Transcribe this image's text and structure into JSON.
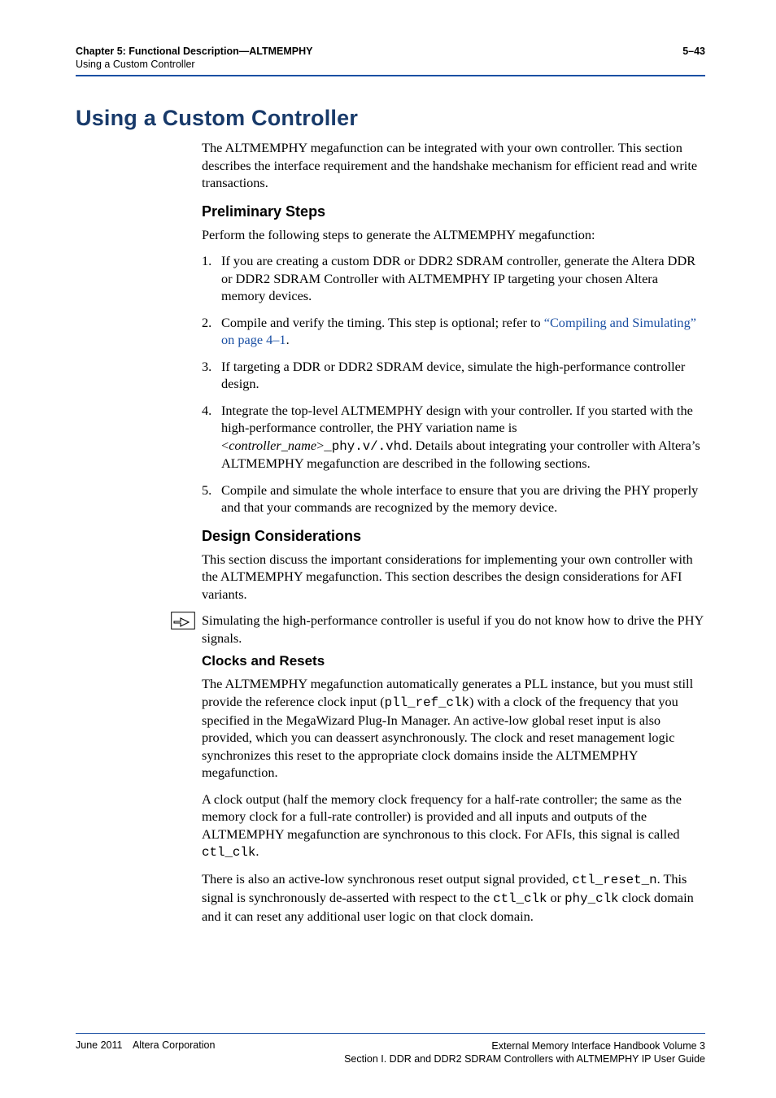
{
  "header": {
    "chapter_line": "Chapter 5: Functional Description—ALTMEMPHY",
    "section_line": "Using a Custom Controller",
    "page_num": "5–43"
  },
  "h1": "Using a Custom Controller",
  "intro": "The ALTMEMPHY megafunction can be integrated with your own controller. This section describes the interface requirement and the handshake mechanism for efficient read and write transactions.",
  "prelim": {
    "title": "Preliminary Steps",
    "lead": "Perform the following steps to generate the ALTMEMPHY megafunction:",
    "steps": {
      "s1": "If you are creating a custom DDR or DDR2 SDRAM controller, generate the Altera DDR or DDR2 SDRAM Controller with ALTMEMPHY IP targeting your chosen Altera memory devices.",
      "s2a": "Compile and verify the timing. This step is optional; refer to ",
      "s2link": "“Compiling and Simulating” on page 4–1",
      "s2b": ".",
      "s3": "If targeting a DDR or DDR2 SDRAM device, simulate the high-performance controller design.",
      "s4a": "Integrate the top-level ALTMEMPHY design with your controller. If you started with the high-performance controller, the PHY variation name is <",
      "s4em": "controller_name",
      "s4b": ">",
      "s4code": "_phy.v/.vhd",
      "s4c": ". Details about integrating your controller with Altera’s ALTMEMPHY megafunction are described in the following sections.",
      "s5": "Compile and simulate the whole interface to ensure that you are driving the PHY properly and that your commands are recognized by the memory device."
    }
  },
  "design": {
    "title": "Design Considerations",
    "p1": "This section discuss the important considerations for implementing your own controller with the ALTMEMPHY megafunction. This section describes the design considerations for AFI variants.",
    "note": "Simulating the high-performance controller is useful if you do not know how to drive the PHY signals."
  },
  "clocks": {
    "title": "Clocks and Resets",
    "p1a": "The ALTMEMPHY megafunction automatically generates a PLL instance, but you must still provide the reference clock input (",
    "p1code1": "pll_ref_clk",
    "p1b": ") with a clock of the frequency that you specified in the MegaWizard Plug-In Manager. An active-low global reset input is also provided, which you can deassert asynchronously. The clock and reset management logic synchronizes this reset to the appropriate clock domains inside the ALTMEMPHY megafunction.",
    "p2a": "A clock output (half the memory clock frequency for a half-rate controller; the same as the memory clock for a full-rate controller) is provided and all inputs and outputs of the ALTMEMPHY megafunction are synchronous to this clock. For AFIs, this signal is called ",
    "p2code1": "ctl_clk",
    "p2b": ".",
    "p3a": "There is also an active-low synchronous reset output signal provided, ",
    "p3code1": "ctl_reset_n",
    "p3b": ". This signal is synchronously de-asserted with respect to the ",
    "p3code2": "ctl_clk",
    "p3c": " or ",
    "p3code3": "phy_clk",
    "p3d": " clock domain and it can reset any additional user logic on that clock domain."
  },
  "footer": {
    "left": "June 2011 Altera Corporation",
    "right1": "External Memory Interface Handbook Volume 3",
    "right2": "Section I. DDR and DDR2 SDRAM Controllers with ALTMEMPHY IP User Guide"
  }
}
